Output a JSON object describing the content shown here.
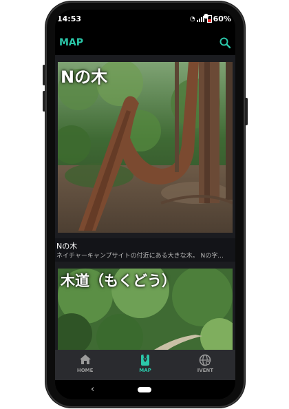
{
  "status": {
    "time": "14:53",
    "battery": "60%"
  },
  "appbar": {
    "title": "MAP",
    "accent": "#2bc7a9"
  },
  "cards": [
    {
      "image_title": "Nの木",
      "name": "Nの木",
      "description": "ネイチャーキャンプサイトの付近にある大きな木。 Nの字..."
    },
    {
      "image_title": "木道（もくどう）"
    }
  ],
  "nav": {
    "items": [
      {
        "label": "HOME",
        "icon": "home-icon",
        "active": false
      },
      {
        "label": "MAP",
        "icon": "map-pin-icon",
        "active": true
      },
      {
        "label": "IVENT",
        "icon": "globe-icon",
        "active": false
      }
    ]
  }
}
